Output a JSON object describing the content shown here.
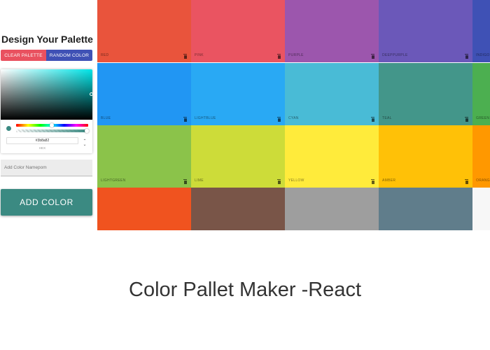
{
  "sidebar": {
    "title": "Design Your Palette",
    "clear_button": "CLEAR PALETTE",
    "random_button": "RANDOM COLOR",
    "picker": {
      "hex_value": "#3b8a82",
      "hex_label": "HEX",
      "current_color": "#3b8a82",
      "saturation_hue_color": "#00e5e8"
    },
    "name_input_placeholder": "Add Color Namepom",
    "add_button": "ADD COLOR",
    "add_button_color": "#3b8a82"
  },
  "palette": {
    "rows": [
      [
        {
          "name": "red",
          "color": "#e9543c"
        },
        {
          "name": "pink",
          "color": "#ea5461"
        },
        {
          "name": "purple",
          "color": "#9c56ad"
        },
        {
          "name": "deeppurple",
          "color": "#6b58b9"
        },
        {
          "name": "indigo",
          "color": "#3f51b5"
        }
      ],
      [
        {
          "name": "blue",
          "color": "#2196f3"
        },
        {
          "name": "lightblue",
          "color": "#29a9f4"
        },
        {
          "name": "cyan",
          "color": "#49bbd6"
        },
        {
          "name": "teal",
          "color": "#43968a"
        },
        {
          "name": "green",
          "color": "#4caf50"
        }
      ],
      [
        {
          "name": "lightgreen",
          "color": "#8bc34a"
        },
        {
          "name": "lime",
          "color": "#cddc39"
        },
        {
          "name": "yellow",
          "color": "#ffeb3b"
        },
        {
          "name": "amber",
          "color": "#ffc107"
        },
        {
          "name": "orange",
          "color": "#ff9800"
        }
      ],
      [
        {
          "name": "",
          "color": "#f0531f"
        },
        {
          "name": "",
          "color": "#795548"
        },
        {
          "name": "",
          "color": "#9e9e9e"
        },
        {
          "name": "",
          "color": "#607d8b"
        },
        {
          "name": "",
          "color": "#f7f7f7"
        }
      ]
    ]
  },
  "caption": "Color Pallet Maker -React"
}
